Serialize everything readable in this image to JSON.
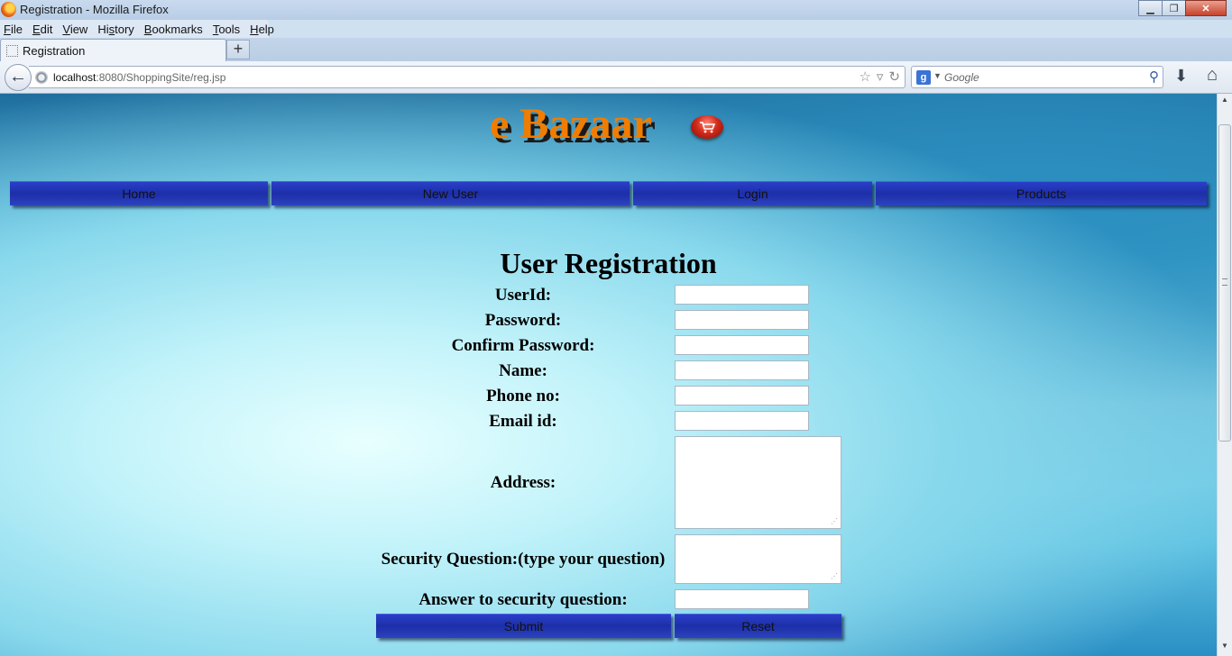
{
  "window": {
    "title": "Registration - Mozilla Firefox",
    "minimize": "▁",
    "maximize": "❐",
    "close": "✕"
  },
  "menu": [
    {
      "label": "File",
      "key": "F"
    },
    {
      "label": "Edit",
      "key": "E"
    },
    {
      "label": "View",
      "key": "V"
    },
    {
      "label": "History",
      "key": "s"
    },
    {
      "label": "Bookmarks",
      "key": "B"
    },
    {
      "label": "Tools",
      "key": "T"
    },
    {
      "label": "Help",
      "key": "H"
    }
  ],
  "tab": {
    "label": "Registration",
    "new_tab": "+"
  },
  "address": {
    "host": "localhost",
    "rest": ":8080/ShoppingSite/reg.jsp"
  },
  "search": {
    "placeholder": "Google"
  },
  "page": {
    "logo": "e Bazaar",
    "nav": {
      "home": "Home",
      "new_user": "New User",
      "login": "Login",
      "products": "Products"
    },
    "title": "User Registration",
    "labels": {
      "userid": "UserId:",
      "password": "Password:",
      "confirm": "Confirm Password:",
      "name": "Name:",
      "phone": "Phone no:",
      "email": "Email id:",
      "address": "Address:",
      "question": "Security Question:(type your question)",
      "answer": "Answer to security question:"
    },
    "values": {
      "userid": "",
      "password": "",
      "confirm": "",
      "name": "",
      "phone": "",
      "email": "",
      "address": "",
      "question": "",
      "answer": ""
    },
    "buttons": {
      "submit": "Submit",
      "reset": "Reset"
    }
  },
  "colors": {
    "logo": "#f07d00",
    "nav_button": "#2234b8"
  }
}
